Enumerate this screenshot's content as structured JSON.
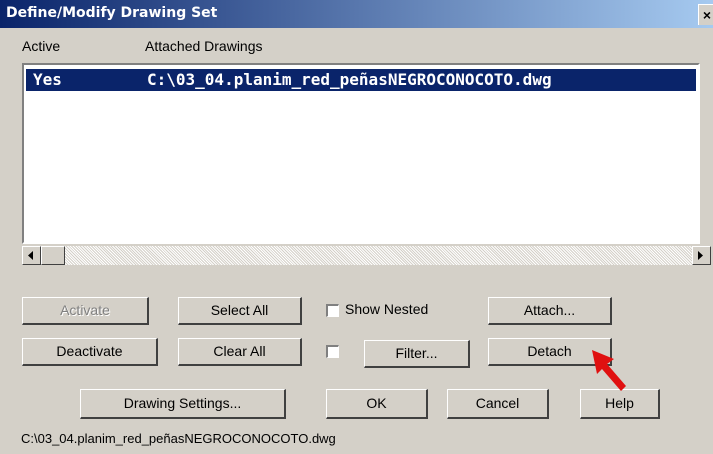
{
  "window": {
    "title": "Define/Modify Drawing Set",
    "close_glyph": "×"
  },
  "list": {
    "columns": [
      "Active",
      "Attached Drawings"
    ],
    "rows": [
      {
        "active": "Yes",
        "drawing": "C:\\03_04.planim_red_peñasNEGROCONOCOTO.dwg",
        "selected": true
      }
    ]
  },
  "buttons": {
    "activate": "Activate",
    "select_all": "Select All",
    "attach": "Attach...",
    "deactivate": "Deactivate",
    "clear_all": "Clear All",
    "filter": "Filter...",
    "detach": "Detach",
    "drawing_settings": "Drawing Settings...",
    "ok": "OK",
    "cancel": "Cancel",
    "help": "Help"
  },
  "checkboxes": {
    "show_nested": {
      "label": "Show Nested",
      "checked": false
    },
    "filter_enabled": {
      "checked": false
    }
  },
  "status": "C:\\03_04.planim_red_peñasNEGROCONOCOTO.dwg",
  "colors": {
    "selection": "#0a246a",
    "dialog": "#d4d0c8",
    "annotation_arrow": "#e01010"
  }
}
